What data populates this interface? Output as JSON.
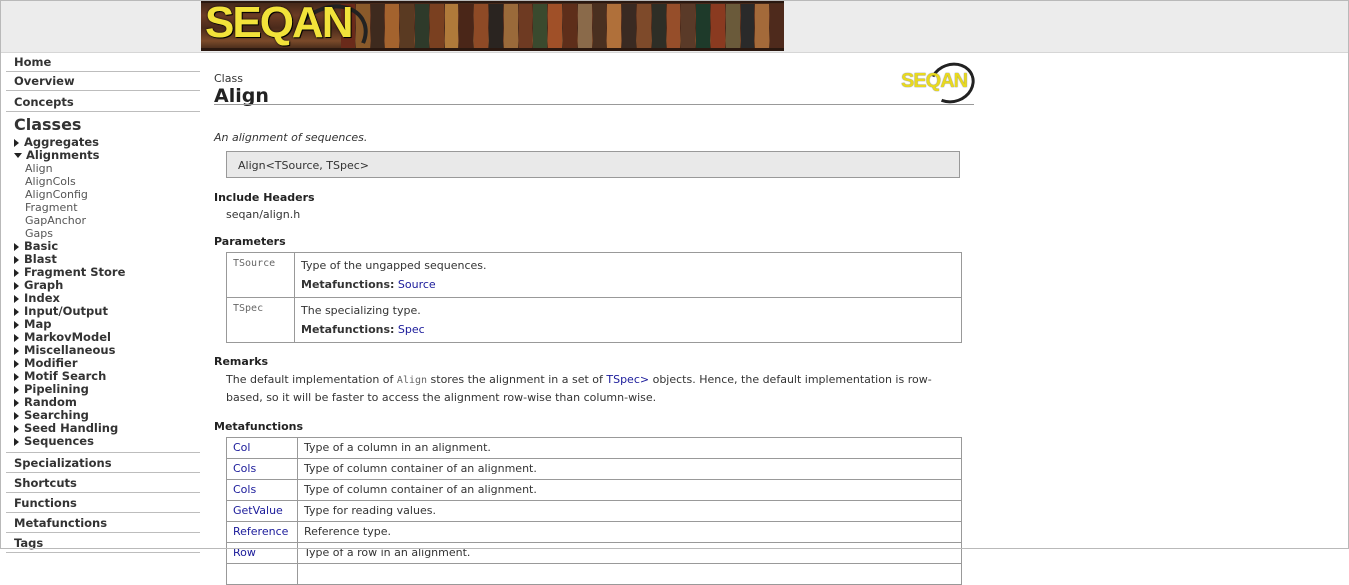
{
  "banner": {
    "logo_text": "SEQAN"
  },
  "sidebar": {
    "top_sections": [
      "Home",
      "Overview",
      "Concepts"
    ],
    "classes_title": "Classes",
    "categories_before": [
      {
        "label": "Aggregates",
        "expanded": false
      }
    ],
    "expanded_category": {
      "label": "Alignments",
      "children": [
        "Align",
        "AlignCols",
        "AlignConfig",
        "Fragment",
        "GapAnchor",
        "Gaps"
      ]
    },
    "categories_after": [
      "Basic",
      "Blast",
      "Fragment Store",
      "Graph",
      "Index",
      "Input/Output",
      "Map",
      "MarkovModel",
      "Miscellaneous",
      "Modifier",
      "Motif Search",
      "Pipelining",
      "Random",
      "Searching",
      "Seed Handling",
      "Sequences"
    ],
    "bottom_sections": [
      "Specializations",
      "Shortcuts",
      "Functions",
      "Metafunctions",
      "Tags"
    ]
  },
  "main": {
    "kind": "Class",
    "title": "Align",
    "logo_text": "SEQAN",
    "description": "An alignment of sequences.",
    "signature": "Align<TSource, TSpec>",
    "include_headers_title": "Include Headers",
    "include_header": "seqan/align.h",
    "parameters_title": "Parameters",
    "parameters": [
      {
        "name": "TSource",
        "description": "Type of the ungapped sequences.",
        "meta_label": "Metafunctions:",
        "meta_link": "Source"
      },
      {
        "name": "TSpec",
        "description": "The specializing type.",
        "meta_label": "Metafunctions:",
        "meta_link": "Spec"
      }
    ],
    "remarks_title": "Remarks",
    "remarks": {
      "part1": "The default implementation of ",
      "code": "Align",
      "part2": " stores the alignment in a set of ",
      "link": "TSpec>",
      "part3": " objects. Hence, the default implementation is row-based, so it will be faster to access the alignment row-wise than column-wise."
    },
    "metafunctions_title": "Metafunctions",
    "metafunctions": [
      {
        "name": "Col",
        "description": "Type of a column in an alignment."
      },
      {
        "name": "Cols",
        "description": "Type of column container of an alignment."
      },
      {
        "name": "Cols",
        "description": "Type of column container of an alignment."
      },
      {
        "name": "GetValue",
        "description": "Type for reading values."
      },
      {
        "name": "Reference",
        "description": "Reference type."
      },
      {
        "name": "Row",
        "description": "Type of a row in an alignment."
      },
      {
        "name": "",
        "description": ""
      }
    ]
  }
}
